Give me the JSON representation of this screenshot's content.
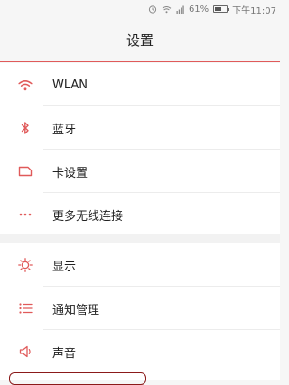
{
  "status_bar": {
    "battery": "61%",
    "battery_level": 0.61,
    "time": "下午11:07"
  },
  "header": {
    "title": "设置"
  },
  "groups": [
    {
      "items": [
        {
          "label": "WLAN",
          "icon": "wifi-icon"
        },
        {
          "label": "蓝牙",
          "icon": "bluetooth-icon"
        },
        {
          "label": "卡设置",
          "icon": "sim-card-icon"
        },
        {
          "label": "更多无线连接",
          "icon": "more-icon"
        }
      ]
    },
    {
      "items": [
        {
          "label": "显示",
          "icon": "brightness-icon"
        },
        {
          "label": "通知管理",
          "icon": "list-icon"
        },
        {
          "label": "声音",
          "icon": "speaker-icon"
        }
      ]
    }
  ],
  "colors": {
    "accent": "#e05a5a",
    "background": "#f6f6f6",
    "row_background": "#ffffff",
    "text": "#222222",
    "highlight_border": "#8b1a1a"
  }
}
